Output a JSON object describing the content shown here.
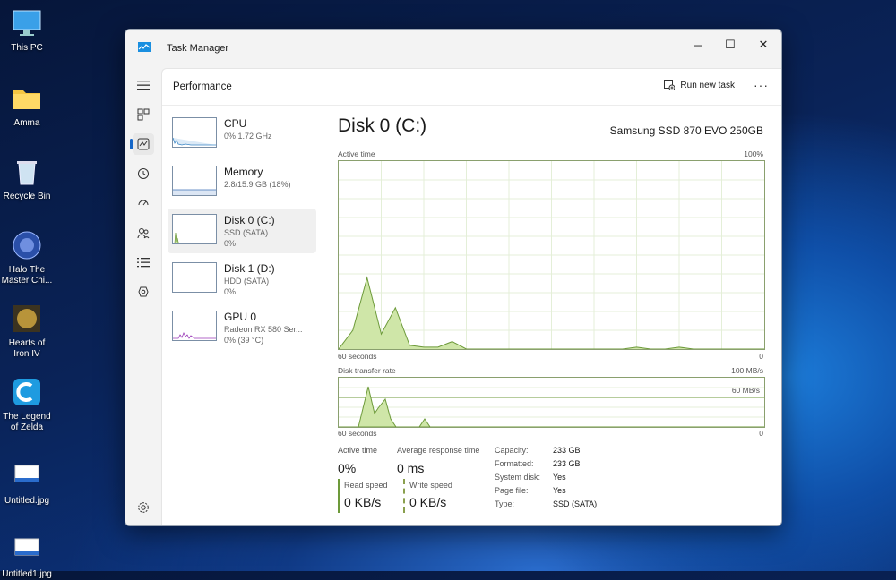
{
  "desktop": {
    "icons": [
      {
        "label": "This PC"
      },
      {
        "label": "Amma"
      },
      {
        "label": "Recycle Bin"
      },
      {
        "label": "Halo The Master Chi..."
      },
      {
        "label": "Hearts of Iron IV"
      },
      {
        "label": "The Legend of Zelda"
      },
      {
        "label": "Untitled.jpg"
      },
      {
        "label": "Untitled1.jpg"
      }
    ]
  },
  "window": {
    "title": "Task Manager",
    "icon": "task-manager-icon",
    "controls": {
      "minimize": "─",
      "maximize": "☐",
      "close": "✕"
    }
  },
  "rail": {
    "items": [
      {
        "icon": "hamburger-icon"
      },
      {
        "icon": "processes-icon"
      },
      {
        "icon": "performance-icon",
        "active": true
      },
      {
        "icon": "app-history-icon"
      },
      {
        "icon": "startup-apps-icon"
      },
      {
        "icon": "users-icon"
      },
      {
        "icon": "details-icon"
      },
      {
        "icon": "services-icon"
      },
      {
        "icon": "settings-icon"
      }
    ]
  },
  "header": {
    "title": "Performance",
    "run_new_task": "Run new task",
    "more": "···"
  },
  "perf_list": [
    {
      "name": "CPU",
      "sub1": "0%  1.72 GHz",
      "sub2": ""
    },
    {
      "name": "Memory",
      "sub1": "2.8/15.9 GB (18%)",
      "sub2": ""
    },
    {
      "name": "Disk 0 (C:)",
      "sub1": "SSD (SATA)",
      "sub2": "0%"
    },
    {
      "name": "Disk 1 (D:)",
      "sub1": "HDD (SATA)",
      "sub2": "0%"
    },
    {
      "name": "GPU 0",
      "sub1": "Radeon RX 580 Ser...",
      "sub2": "0%  (39 °C)"
    }
  ],
  "detail": {
    "title": "Disk 0 (C:)",
    "model": "Samsung SSD 870 EVO 250GB",
    "active_time_label": "Active time",
    "active_time_max": "100%",
    "graph_time_left": "60 seconds",
    "graph_time_right": "0",
    "transfer_label": "Disk transfer rate",
    "transfer_max": "100 MB/s",
    "transfer_mid": "60 MB/s",
    "stats": {
      "active_time_label": "Active time",
      "active_time_value": "0%",
      "avg_resp_label": "Average response time",
      "avg_resp_value": "0 ms",
      "read_label": "Read speed",
      "read_value": "0 KB/s",
      "write_label": "Write speed",
      "write_value": "0 KB/s"
    },
    "info": [
      {
        "k": "Capacity:",
        "v": "233 GB"
      },
      {
        "k": "Formatted:",
        "v": "233 GB"
      },
      {
        "k": "System disk:",
        "v": "Yes"
      },
      {
        "k": "Page file:",
        "v": "Yes"
      },
      {
        "k": "Type:",
        "v": "SSD (SATA)"
      }
    ]
  },
  "chart_data": {
    "type": "area",
    "title": "Active time",
    "x": [
      60,
      58,
      56,
      54,
      52,
      50,
      48,
      46,
      44,
      42,
      40,
      38,
      36,
      34,
      32,
      30,
      28,
      26,
      24,
      22,
      20,
      18,
      16,
      14,
      12,
      10,
      8,
      6,
      4,
      2,
      0
    ],
    "series": [
      {
        "name": "Active time",
        "values": [
          0,
          10,
          38,
          8,
          22,
          2,
          1,
          1,
          4,
          0,
          0,
          0,
          0,
          0,
          0,
          0,
          0,
          0,
          0,
          0,
          0,
          1,
          0,
          0,
          1,
          0,
          0,
          0,
          0,
          0,
          0
        ]
      }
    ],
    "ylim": [
      0,
      100
    ],
    "colors": {
      "line": "#6d9a3a",
      "fill": "#cfe6a8"
    }
  }
}
